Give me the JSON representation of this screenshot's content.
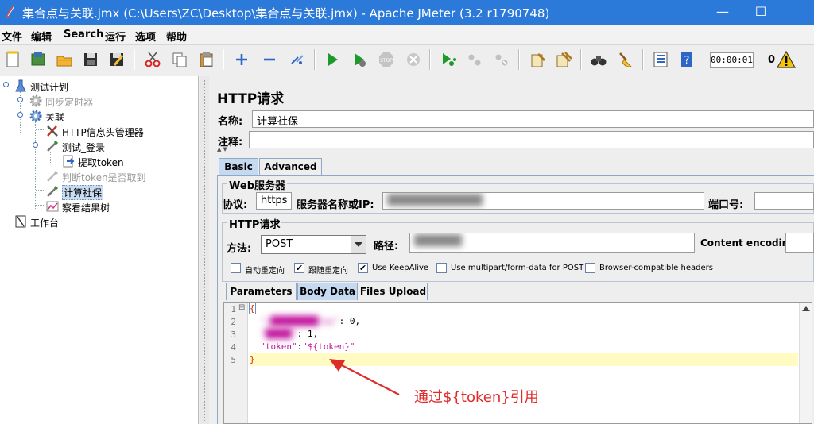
{
  "window": {
    "title": "集合点与关联.jmx (C:\\Users\\ZC\\Desktop\\集合点与关联.jmx) - Apache JMeter (3.2 r1790748)",
    "minimize_glyph": "—",
    "maximize_glyph": "☐"
  },
  "menu": [
    "文件",
    "编辑",
    "Search",
    "运行",
    "选项",
    "帮助"
  ],
  "toolbar": {
    "icons": [
      "new-icon",
      "templates-icon",
      "open-icon",
      "save-icon",
      "save-as-icon",
      "cut-icon",
      "copy-icon",
      "paste-icon",
      "expand-icon",
      "collapse-icon",
      "toggle-icon",
      "start-icon",
      "start-no-pause-icon",
      "stop-icon",
      "shutdown-icon",
      "remote-start-icon",
      "remote-stop-icon",
      "remote-shutdown-icon",
      "clear-icon",
      "clear-all-icon",
      "search-icon",
      "reset-search-icon",
      "function-helper-icon",
      "help-icon"
    ],
    "timer": "00:00:01",
    "error_count": "0"
  },
  "tree": {
    "nodes": [
      {
        "label": "测试计划",
        "icon": "test-plan-icon",
        "disabled": false,
        "selected": false
      },
      {
        "label": "同步定时器",
        "icon": "gear-icon",
        "disabled": true,
        "selected": false
      },
      {
        "label": "关联",
        "icon": "gear-icon",
        "disabled": false,
        "selected": false
      },
      {
        "label": "HTTP信息头管理器",
        "icon": "tools-icon",
        "disabled": false,
        "selected": false
      },
      {
        "label": "测试_登录",
        "icon": "pipette-icon",
        "disabled": false,
        "selected": false
      },
      {
        "label": "提取token",
        "icon": "extractor-icon",
        "disabled": false,
        "selected": false
      },
      {
        "label": "判断token是否取到",
        "icon": "pipette-icon",
        "disabled": true,
        "selected": false
      },
      {
        "label": "计算社保",
        "icon": "pipette-icon",
        "disabled": false,
        "selected": true
      },
      {
        "label": "察看结果树",
        "icon": "results-tree-icon",
        "disabled": false,
        "selected": false
      },
      {
        "label": "工作台",
        "icon": "workbench-icon",
        "disabled": false,
        "selected": false
      }
    ]
  },
  "sampler": {
    "title": "HTTP请求",
    "name_label": "名称:",
    "name_value": "计算社保",
    "comment_label": "注释:",
    "comment_value": "",
    "main_tabs": [
      "Basic",
      "Advanced"
    ],
    "web_server": {
      "group_title": "Web服务器",
      "protocol_label": "协议:",
      "protocol_value": "https",
      "server_label": "服务器名称或IP:",
      "port_label": "端口号:",
      "port_value": ""
    },
    "http_request": {
      "group_title": "HTTP请求",
      "method_label": "方法:",
      "method_value": "POST",
      "path_label": "路径:",
      "encoding_label": "Content encoding:",
      "encoding_value": ""
    },
    "checkboxes": [
      {
        "label": "自动重定向",
        "checked": false
      },
      {
        "label": "跟随重定向",
        "checked": true
      },
      {
        "label": "Use KeepAlive",
        "checked": true
      },
      {
        "label": "Use multipart/form-data for POST",
        "checked": false
      },
      {
        "label": "Browser-compatible headers",
        "checked": false
      }
    ],
    "body_tabs": [
      "Parameters",
      "Body Data",
      "Files Upload"
    ],
    "active_body_tab": "Body Data"
  },
  "editor": {
    "line_numbers": [
      "1",
      "2",
      "3",
      "4",
      "5"
    ],
    "fold_marker": "⊟",
    "open_brace": "{",
    "close_brace": "}",
    "line2_value": ": 0,",
    "line3_value": ": 1,",
    "token_key": "\"token\"",
    "token_colon": ":",
    "token_value": "\"${token}\""
  },
  "annotation": {
    "text": "通过${token}引用",
    "color": "#e02b2b"
  },
  "colors": {
    "titlebar": "#2b79d9",
    "active_tab": "#c5d9f1",
    "current_line": "#fffbc2",
    "string_token": "#c2159e"
  }
}
